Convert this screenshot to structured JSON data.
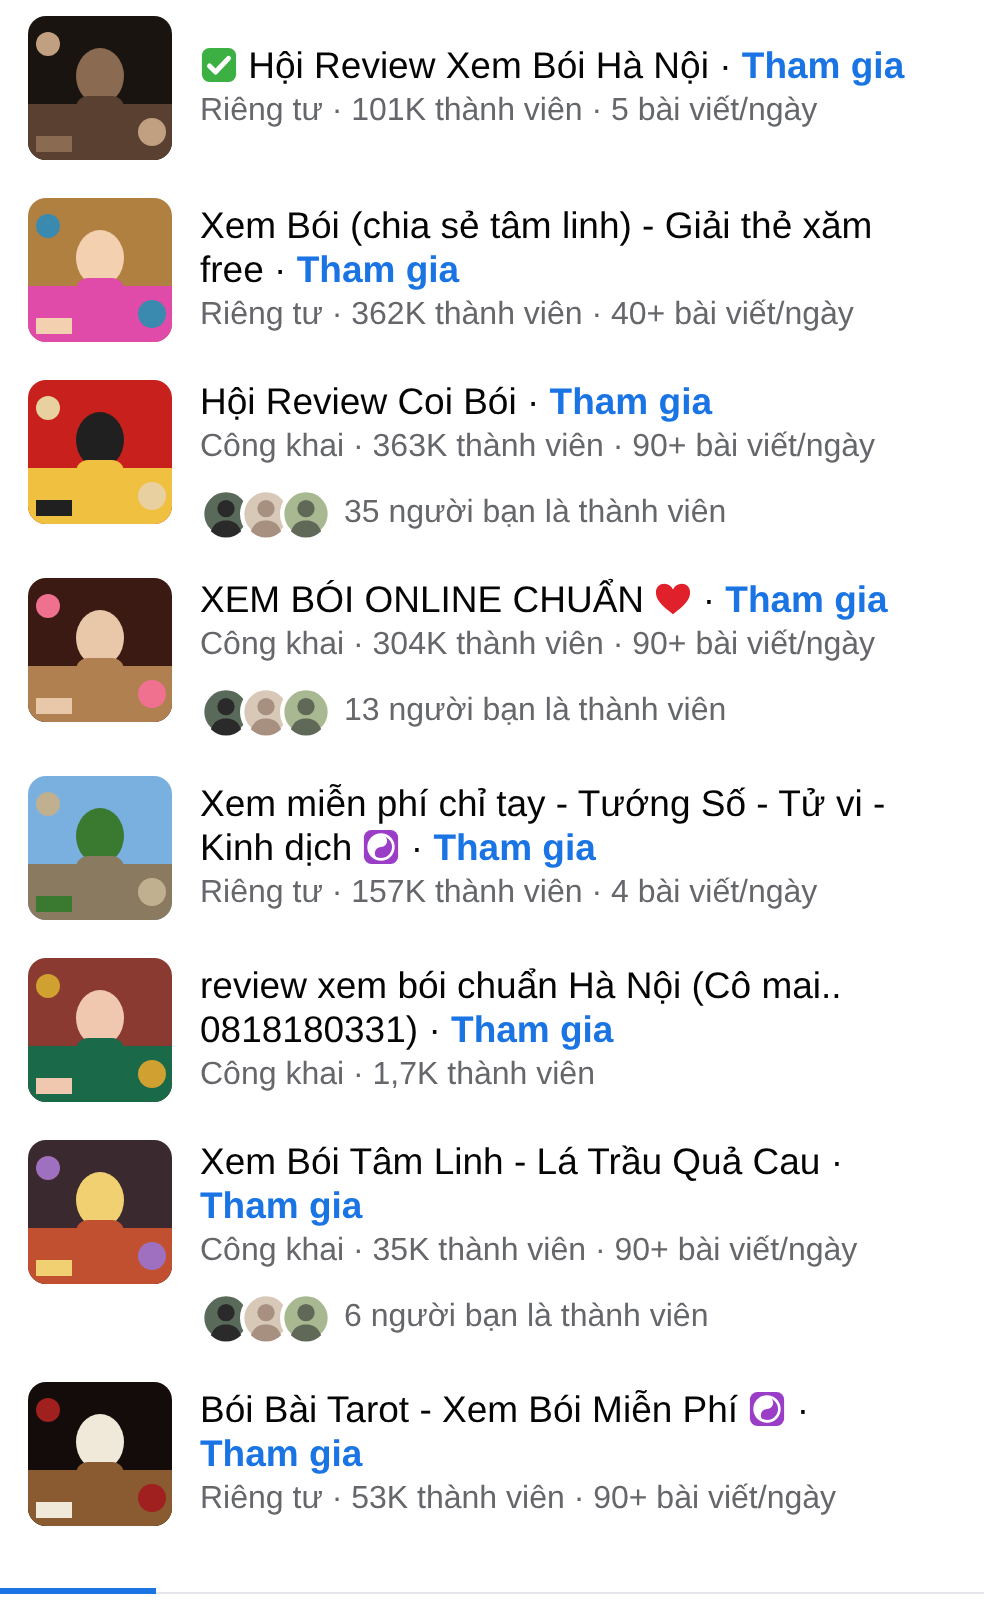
{
  "groups": [
    {
      "lead_icon": {
        "kind": "check"
      },
      "title": "Hội Review Xem Bói Hà Nội",
      "separator": "·",
      "join": "Tham gia",
      "meta": "Riêng tư · 101K thành viên · 5 bài viết/ngày"
    },
    {
      "title": "Xem Bói (chia sẻ tâm linh) - Giải thẻ xăm free",
      "separator": "·",
      "join": "Tham gia",
      "meta": "Riêng tư · 362K thành viên · 40+ bài viết/ngày"
    },
    {
      "title": "Hội Review Coi Bói",
      "separator": "·",
      "join": "Tham gia",
      "meta": "Công khai · 363K thành viên · 90+ bài viết/ngày",
      "friends": {
        "text": "35 người bạn là thành viên",
        "avatars": [
          {
            "kind": "avatar"
          },
          {
            "kind": "avatar"
          },
          {
            "kind": "avatar"
          }
        ]
      }
    },
    {
      "title": "XEM BÓI ONLINE CHUẨN",
      "trail_icon": {
        "kind": "heart"
      },
      "separator": "·",
      "join": "Tham gia",
      "meta": "Công khai · 304K thành viên · 90+ bài viết/ngày",
      "friends": {
        "text": "13 người bạn là thành viên",
        "avatars": [
          {
            "kind": "avatar"
          },
          {
            "kind": "avatar"
          },
          {
            "kind": "avatar"
          }
        ]
      }
    },
    {
      "title": "Xem miễn phí chỉ tay - Tướng Số - Tử vi - Kinh dịch",
      "trail_icon": {
        "kind": "yin-yang"
      },
      "separator": "·",
      "join": "Tham gia",
      "meta": "Riêng tư · 157K thành viên · 4 bài viết/ngày"
    },
    {
      "title": "review xem bói chuẩn Hà Nội (Cô mai.. 0818180331)",
      "separator": "·",
      "join": "Tham gia",
      "meta": "Công khai · 1,7K thành viên"
    },
    {
      "title": "Xem Bói Tâm Linh - Lá Trầu Quả Cau",
      "separator": "·",
      "join": "Tham gia",
      "meta": "Công khai · 35K thành viên · 90+ bài viết/ngày",
      "friends": {
        "text": "6 người bạn là thành viên",
        "avatars": [
          {
            "kind": "avatar"
          },
          {
            "kind": "avatar"
          },
          {
            "kind": "avatar"
          }
        ]
      }
    },
    {
      "title": "Bói Bài Tarot - Xem Bói Miễn Phí",
      "trail_icon": {
        "kind": "yin-yang"
      },
      "separator": "·",
      "join": "Tham gia",
      "meta": "Riêng tư · 53K thành viên · 90+ bài viết/ngày"
    }
  ]
}
